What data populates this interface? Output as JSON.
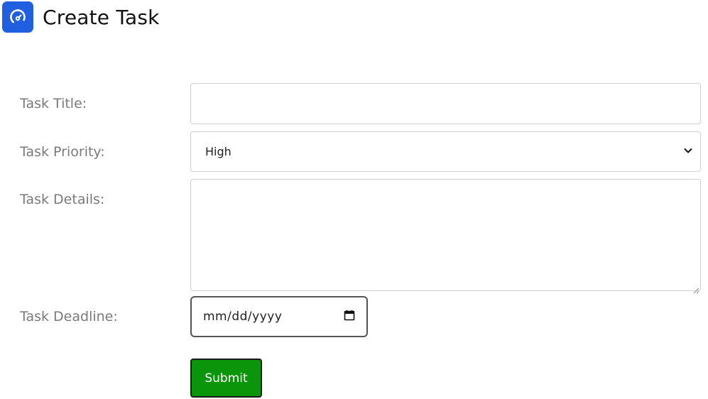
{
  "header": {
    "title": "Create Task",
    "logo_icon": "speedometer-icon",
    "logo_color": "#1f5fe0"
  },
  "form": {
    "title_label": "Task Title:",
    "title_value": "",
    "priority_label": "Task Priority:",
    "priority_selected": "High",
    "details_label": "Task Details:",
    "details_value": "",
    "deadline_label": "Task Deadline:",
    "deadline_placeholder": "mm/dd/yyyy",
    "submit_label": "Submit",
    "submit_color": "#0a950a"
  }
}
